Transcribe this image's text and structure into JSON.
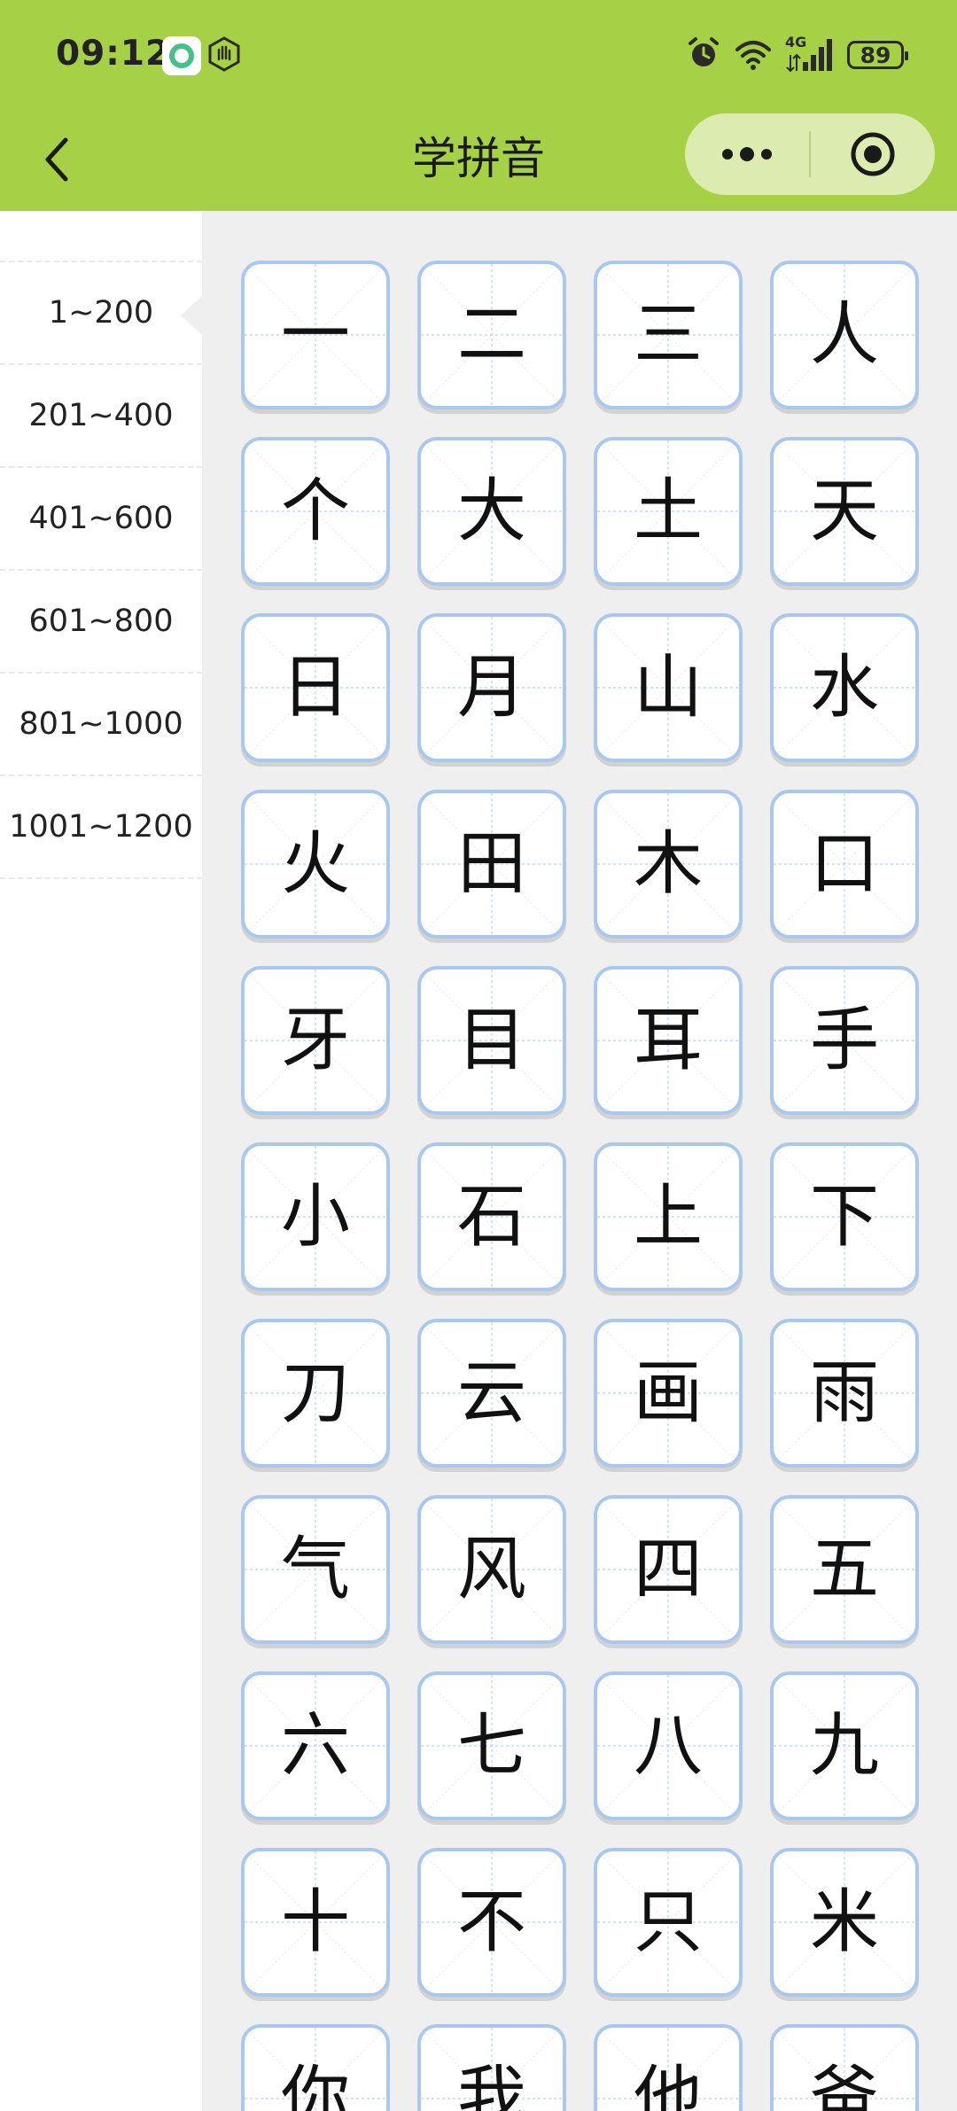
{
  "status_bar": {
    "time": "09:12",
    "network": "4G",
    "battery": "89"
  },
  "nav": {
    "title": "学拼音"
  },
  "sidebar": {
    "items": [
      {
        "label": "1~200",
        "active": true
      },
      {
        "label": "201~400",
        "active": false
      },
      {
        "label": "401~600",
        "active": false
      },
      {
        "label": "601~800",
        "active": false
      },
      {
        "label": "801~1000",
        "active": false
      },
      {
        "label": "1001~1200",
        "active": false
      }
    ]
  },
  "characters": [
    "一",
    "二",
    "三",
    "人",
    "个",
    "大",
    "土",
    "天",
    "日",
    "月",
    "山",
    "水",
    "火",
    "田",
    "木",
    "口",
    "牙",
    "目",
    "耳",
    "手",
    "小",
    "石",
    "上",
    "下",
    "刀",
    "云",
    "画",
    "雨",
    "气",
    "风",
    "四",
    "五",
    "六",
    "七",
    "八",
    "九",
    "十",
    "不",
    "只",
    "米",
    "你",
    "我",
    "他",
    "爸"
  ],
  "colors": {
    "header_bg": "#a6d045",
    "capsule_bg": "#dcecb0",
    "cell_border": "#a9c8ef",
    "main_bg": "#efefef"
  }
}
